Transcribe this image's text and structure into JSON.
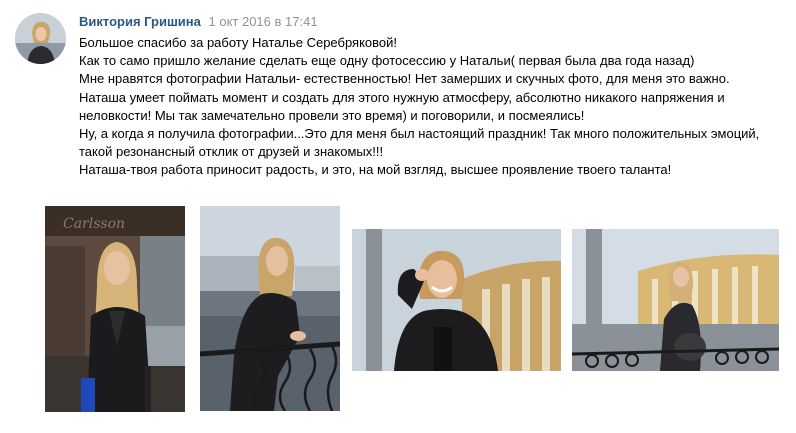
{
  "post": {
    "author": "Виктория Гришина",
    "date": "1 окт 2016 в 17:41",
    "lines": [
      "Большое спасибо за работу Наталье Серебряковой!",
      "Как то само пришло желание сделать еще одну фотосессию у Натальи( первая была два года назад)",
      "Мне нравятся фотографии Натальи- естественностью! Нет замерших и скучных фото, для меня это важно.",
      "Наташа умеет поймать момент и создать для этого нужную атмосферу, абсолютно никакого напряжения и",
      "неловкости! Мы так замечательно провели это время) и поговорили, и посмеялись!",
      "Ну, а когда я получила фотографии...Это для меня был настоящий праздник! Так много положительных эмоций,",
      "такой резонансный отклик от друзей и знакомых!!!",
      "Наташа-твоя работа приносит радость, и это, на мой взгляд, высшее проявление твоего таланта!"
    ]
  },
  "photos": [
    {
      "scene": "woman in leather jacket on city street near cafe window"
    },
    {
      "scene": "woman in black dress leaning on embankment railing"
    },
    {
      "scene": "smiling woman in leather jacket near stadium"
    },
    {
      "scene": "woman standing by railing near stadium colonnade"
    }
  ]
}
